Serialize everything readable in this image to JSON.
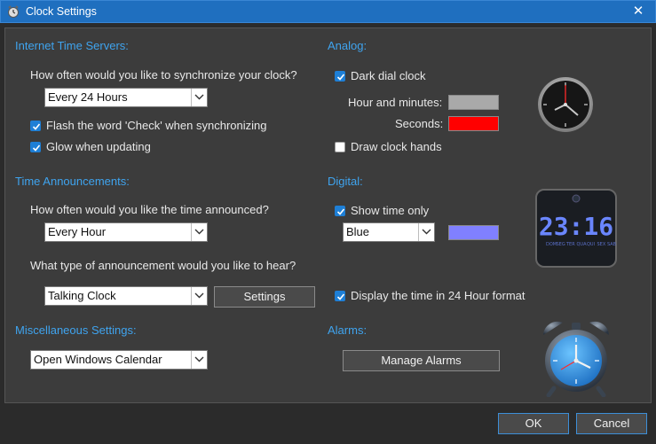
{
  "window": {
    "title": "Clock Settings",
    "close_glyph": "✕"
  },
  "internet": {
    "title": "Internet Time Servers:",
    "question": "How often would you like to synchronize your clock?",
    "frequency_value": "Every 24 Hours",
    "flash_label": "Flash the word 'Check' when synchronizing",
    "flash_checked": true,
    "glow_label": "Glow when updating",
    "glow_checked": true
  },
  "announcements": {
    "title": "Time Announcements:",
    "question": "How often would you like the time announced?",
    "frequency_value": "Every Hour",
    "type_question": "What type of announcement would you like to hear?",
    "type_value": "Talking Clock",
    "settings_label": "Settings"
  },
  "misc": {
    "title": "Miscellaneous Settings:",
    "value": "Open Windows Calendar"
  },
  "analog": {
    "title": "Analog:",
    "dark_dial_label": "Dark dial clock",
    "dark_dial_checked": true,
    "hour_minutes_label": "Hour and minutes:",
    "hour_minutes_color": "#a9a9a9",
    "seconds_label": "Seconds:",
    "seconds_color": "#ff0000",
    "draw_hands_label": "Draw clock hands",
    "draw_hands_checked": false
  },
  "digital": {
    "title": "Digital:",
    "show_time_only_label": "Show time only",
    "show_time_only_checked": true,
    "color_value": "Blue",
    "color_swatch": "#8080ff",
    "format_24_label": "Display the time in 24 Hour format",
    "format_24_checked": true,
    "preview_time": "23:16",
    "preview_days": [
      "DOM",
      "SEG",
      "TER",
      "QUA",
      "QUI",
      "SEX",
      "SAB"
    ]
  },
  "alarms": {
    "title": "Alarms:",
    "manage_label": "Manage Alarms"
  },
  "footer": {
    "ok_label": "OK",
    "cancel_label": "Cancel"
  },
  "colors": {
    "accent": "#3fa4ef",
    "titlebar": "#1f6fbf",
    "check": "#1e7fd6"
  }
}
